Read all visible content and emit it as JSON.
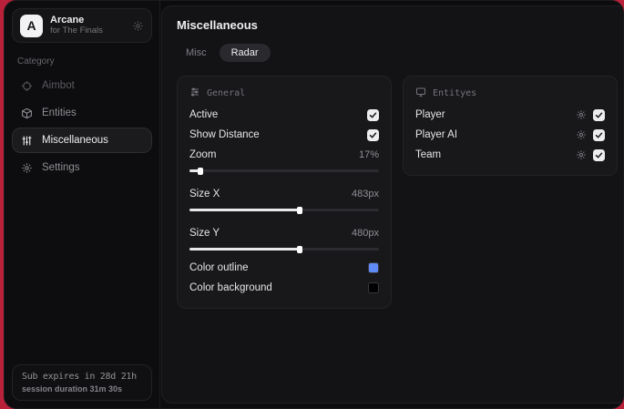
{
  "app": {
    "name": "Arcane",
    "subtitle": "for The Finals",
    "logo_letter": "A"
  },
  "sidebar": {
    "category_label": "Category",
    "items": [
      {
        "label": "Aimbot",
        "icon": "crosshair-icon"
      },
      {
        "label": "Entities",
        "icon": "cube-icon"
      },
      {
        "label": "Miscellaneous",
        "icon": "sliders-icon"
      },
      {
        "label": "Settings",
        "icon": "gear-icon"
      }
    ],
    "footer": {
      "line1": "Sub expires in 28d 21h",
      "line2": "session duration 31m 30s"
    }
  },
  "main": {
    "title": "Miscellaneous",
    "tabs": [
      {
        "label": "Misc"
      },
      {
        "label": "Radar"
      }
    ],
    "panels": {
      "general": {
        "title": "General",
        "rows": {
          "active": {
            "label": "Active",
            "checked": true
          },
          "show_distance": {
            "label": "Show Distance",
            "checked": true
          },
          "zoom": {
            "label": "Zoom",
            "value": "17%",
            "fill": "6%"
          },
          "size_x": {
            "label": "Size X",
            "value": "483px",
            "fill": "58%"
          },
          "size_y": {
            "label": "Size Y",
            "value": "480px",
            "fill": "58%"
          },
          "color_outline": {
            "label": "Color outline",
            "color": "#5e8bf5"
          },
          "color_background": {
            "label": "Color background",
            "color": "#000000"
          }
        }
      },
      "entities": {
        "title": "Entityes",
        "rows": [
          {
            "label": "Player",
            "checked": true
          },
          {
            "label": "Player AI",
            "checked": true
          },
          {
            "label": "Team",
            "checked": true
          }
        ]
      }
    }
  },
  "colors": {
    "backdrop_red": "#b92039",
    "outline_blue": "#5e8bf5"
  }
}
